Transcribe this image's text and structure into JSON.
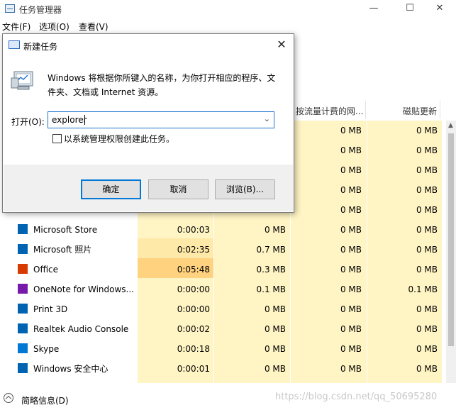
{
  "window": {
    "title": "任务管理器",
    "controls": {
      "minimize": "—",
      "maximize": "☐",
      "close": "✕"
    }
  },
  "menu": [
    "文件(F)",
    "选项(O)",
    "查看(V)"
  ],
  "columns": {
    "network_metered": "按流量计费的网...",
    "tile_update": "磁贴更新"
  },
  "rows": [
    {
      "name": "",
      "cpu_time": "",
      "network": "",
      "metered": "0 MB",
      "tile": "0 MB"
    },
    {
      "name": "",
      "cpu_time": "",
      "network": "",
      "metered": "0 MB",
      "tile": "0 MB"
    },
    {
      "name": "",
      "cpu_time": "",
      "network": "",
      "metered": "0 MB",
      "tile": "0 MB"
    },
    {
      "name": "",
      "cpu_time": "",
      "network": "",
      "metered": "0 MB",
      "tile": "0 MB"
    },
    {
      "name": "",
      "cpu_time": "",
      "network": "",
      "metered": "0 MB",
      "tile": "0 MB"
    },
    {
      "name": "Microsoft Store",
      "cpu_time": "0:00:03",
      "network": "0 MB",
      "metered": "0 MB",
      "tile": "0 MB",
      "icon": "store-icon",
      "color": "#0063b1"
    },
    {
      "name": "Microsoft 照片",
      "cpu_time": "0:02:35",
      "network": "0.7 MB",
      "metered": "0 MB",
      "tile": "0 MB",
      "icon": "photos-icon",
      "color": "#0063b1"
    },
    {
      "name": "Office",
      "cpu_time": "0:05:48",
      "network": "0.3 MB",
      "metered": "0 MB",
      "tile": "0 MB",
      "icon": "office-icon",
      "color": "#d83b01"
    },
    {
      "name": "OneNote for Windows...",
      "cpu_time": "0:00:00",
      "network": "0.1 MB",
      "metered": "0 MB",
      "tile": "0.1 MB",
      "icon": "onenote-icon",
      "color": "#7719aa"
    },
    {
      "name": "Print 3D",
      "cpu_time": "0:00:00",
      "network": "0 MB",
      "metered": "0 MB",
      "tile": "0 MB",
      "icon": "print3d-icon",
      "color": "#0063b1"
    },
    {
      "name": "Realtek Audio Console",
      "cpu_time": "0:00:02",
      "network": "0 MB",
      "metered": "0 MB",
      "tile": "0 MB",
      "icon": "audio-icon",
      "color": "#0063b1"
    },
    {
      "name": "Skype",
      "cpu_time": "0:00:18",
      "network": "0 MB",
      "metered": "0 MB",
      "tile": "0 MB",
      "icon": "skype-icon",
      "color": "#0078d4"
    },
    {
      "name": "Windows 安全中心",
      "cpu_time": "0:00:01",
      "network": "0 MB",
      "metered": "0 MB",
      "tile": "0 MB",
      "icon": "shield-icon",
      "color": "#0063b1"
    }
  ],
  "footer": {
    "fewer_details": "简略信息(D)",
    "watermark": "https://blog.csdn.net/qq_50695280"
  },
  "dialog": {
    "title": "新建任务",
    "description": "Windows 将根据你所键入的名称，为你打开相应的程序、文件夹、文档或 Internet 资源。",
    "open_label": "打开(O):",
    "open_value": "explorer",
    "admin_label": "以系统管理权限创建此任务。",
    "ok": "确定",
    "cancel": "取消",
    "browse": "浏览(B)...",
    "close": "✕"
  }
}
